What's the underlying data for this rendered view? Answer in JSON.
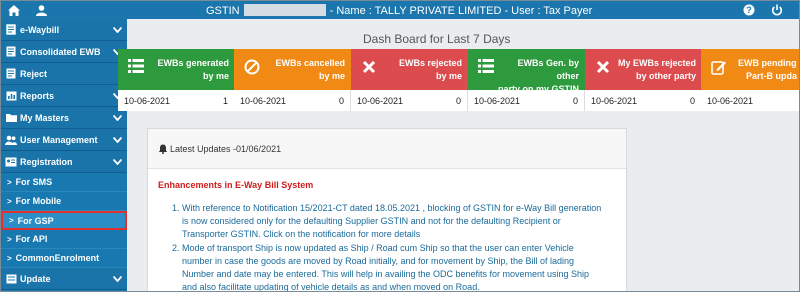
{
  "topbar": {
    "gstin_label": "GSTIN",
    "title_rest": "- Name : TALLY PRIVATE LIMITED - User : Tax Payer",
    "home_icon": "home-icon",
    "user_icon": "user-icon",
    "help_icon": "help-icon",
    "power_icon": "power-icon"
  },
  "sidebar": {
    "items": [
      {
        "label": "e-Waybill",
        "chevron": true
      },
      {
        "label": "Consolidated EWB",
        "chevron": true
      },
      {
        "label": "Reject",
        "chevron": false
      },
      {
        "label": "Reports",
        "chevron": true
      },
      {
        "label": "My Masters",
        "chevron": true
      },
      {
        "label": "User Management",
        "chevron": true
      },
      {
        "label": "Registration",
        "chevron": true
      }
    ],
    "subitems": [
      {
        "label": "For SMS"
      },
      {
        "label": "For Mobile"
      },
      {
        "label": "For GSP"
      },
      {
        "label": "For API"
      },
      {
        "label": "CommonEnrolment"
      }
    ],
    "bottom": {
      "label": "Update"
    }
  },
  "dashboard": {
    "title": "Dash Board for Last 7 Days",
    "cards": [
      {
        "label": "EWBs generated by me",
        "line1": "EWBs generated",
        "line2": "by me",
        "date": "10-06-2021",
        "count": "1",
        "color": "#2e9a3e",
        "icon": "list-icon"
      },
      {
        "label": "EWBs cancelled by me",
        "line1": "EWBs cancelled",
        "line2": "by me",
        "date": "10-06-2021",
        "count": "0",
        "color": "#f08a14",
        "icon": "ban-icon"
      },
      {
        "label": "EWBs rejected by me",
        "line1": "EWBs rejected",
        "line2": "by me",
        "date": "10-06-2021",
        "count": "0",
        "color": "#dc4c4e",
        "icon": "x-icon"
      },
      {
        "label": "EWBs Gen. by other party on my GSTIN",
        "line1": "EWBs Gen. by other",
        "line2": "party on my GSTIN",
        "date": "10-06-2021",
        "count": "0",
        "color": "#2e9a3e",
        "icon": "list-icon"
      },
      {
        "label": "My EWBs rejected by other party",
        "line1": "My EWBs rejected",
        "line2": "by other party",
        "date": "10-06-2021",
        "count": "0",
        "color": "#dc4c4e",
        "icon": "x-icon"
      },
      {
        "label": "EWB pending Part-B update",
        "line1": "EWB pending",
        "line2": "Part-B upda",
        "date": "10-06-2021",
        "count": "",
        "color": "#f08a14",
        "icon": "edit-icon"
      }
    ]
  },
  "updates": {
    "header": "Latest Updates -01/06/2021",
    "heading": "Enhancements in E-Way Bill System",
    "items": [
      "With reference to Notification 15/2021-CT dated 18.05.2021 , blocking of GSTIN for e-Way Bill generation is now considered only for the defaulting Supplier GSTIN and not for the defaulting Recipient or Transporter GSTIN. Click on the notification for more details",
      "Mode of transport Ship is now updated as Ship / Road cum Ship so that the user can enter Vehicle number in case the goods are moved by Road initially, and for movement by Ship, the Bill of lading Number and date may be entered. This will help in availing the ODC benefits for movement using Ship and also facilitate updating of vehicle details as and when moved on Road."
    ]
  },
  "colors": {
    "topbar": "#1a76ad",
    "sidebar": "#1878b0",
    "green": "#2e9a3e",
    "orange": "#f08a14",
    "red": "#dc4c4e",
    "highlight_border": "#e0312f"
  }
}
